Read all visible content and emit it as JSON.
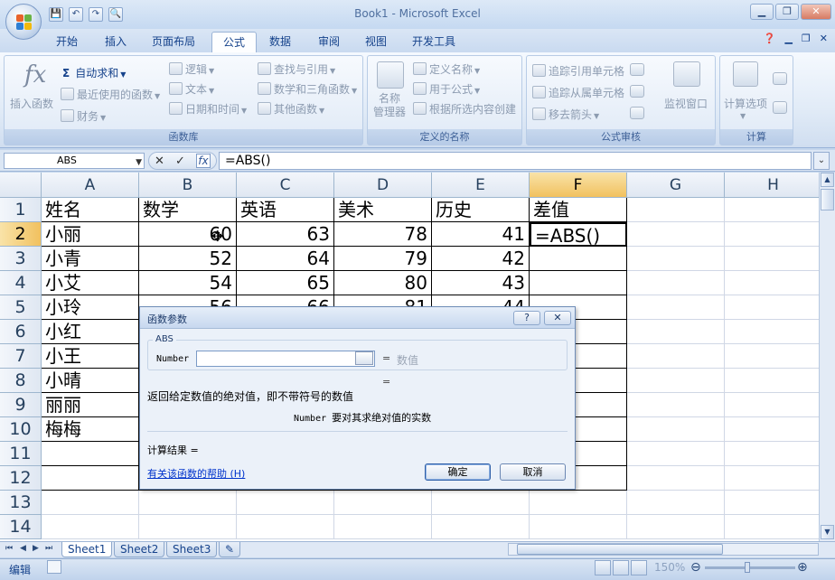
{
  "app": {
    "title": "Book1 - Microsoft Excel",
    "qat": [
      "💾",
      "↶",
      "↷",
      "🔍"
    ]
  },
  "tabs": [
    "开始",
    "插入",
    "页面布局",
    "公式",
    "数据",
    "审阅",
    "视图",
    "开发工具"
  ],
  "active_tab": "公式",
  "ribbon": {
    "library": {
      "label": "函数库",
      "insert_function": "插入函数",
      "autosum": "自动求和",
      "recent": "最近使用的函数",
      "finance": "财务",
      "logic": "逻辑",
      "text": "文本",
      "datetime": "日期和时间",
      "lookup": "查找与引用",
      "math": "数学和三角函数",
      "other": "其他函数"
    },
    "names": {
      "label": "定义的名称",
      "manager": "名称\n管理器",
      "define": "定义名称",
      "use_in_formula": "用于公式",
      "create_from_selection": "根据所选内容创建"
    },
    "audit": {
      "label": "公式审核",
      "trace_precedents": "追踪引用单元格",
      "trace_dependents": "追踪从属单元格",
      "remove_arrows": "移去箭头",
      "watch_window": "监视窗口"
    },
    "calc": {
      "label": "计算",
      "options": "计算选项"
    }
  },
  "formula_bar": {
    "name_box": "ABS",
    "formula": "=ABS()",
    "cancel": "✕",
    "enter": "✓",
    "fx": "fx"
  },
  "grid": {
    "columns": [
      "A",
      "B",
      "C",
      "D",
      "E",
      "F",
      "G",
      "H"
    ],
    "selected_column": "F",
    "rows": [
      "1",
      "2",
      "3",
      "4",
      "5",
      "6",
      "7",
      "8",
      "9",
      "10",
      "11",
      "12",
      "13",
      "14"
    ],
    "selected_row": "2",
    "data": [
      [
        "姓名",
        "数学",
        "英语",
        "美术",
        "历史",
        "差值"
      ],
      [
        "小丽",
        "60",
        "63",
        "78",
        "41",
        "=ABS()"
      ],
      [
        "小青",
        "52",
        "64",
        "79",
        "42",
        ""
      ],
      [
        "小艾",
        "54",
        "65",
        "80",
        "43",
        ""
      ],
      [
        "小玲",
        "56",
        "66",
        "81",
        "44",
        ""
      ],
      [
        "小红",
        "",
        "",
        "",
        "",
        ""
      ],
      [
        "小王",
        "",
        "",
        "",
        "",
        ""
      ],
      [
        "小晴",
        "",
        "",
        "",
        "",
        ""
      ],
      [
        "丽丽",
        "",
        "",
        "",
        "",
        ""
      ],
      [
        "梅梅",
        "",
        "",
        "",
        "",
        ""
      ]
    ]
  },
  "sheets": [
    "Sheet1",
    "Sheet2",
    "Sheet3"
  ],
  "active_sheet": "Sheet1",
  "status": {
    "mode": "编辑",
    "zoom": "150%"
  },
  "dialog": {
    "title": "函数参数",
    "help_btn": "?",
    "close_btn": "✕",
    "function_name": "ABS",
    "arg_name": "Number",
    "arg_value_hint": "数值",
    "equals": "=",
    "description": "返回给定数值的绝对值，即不带符号的数值",
    "arg_label": "Number",
    "arg_description": "要对其求绝对值的实数",
    "result_label": "计算结果 =",
    "help_link": "有关该函数的帮助 (H)",
    "ok": "确定",
    "cancel": "取消"
  }
}
